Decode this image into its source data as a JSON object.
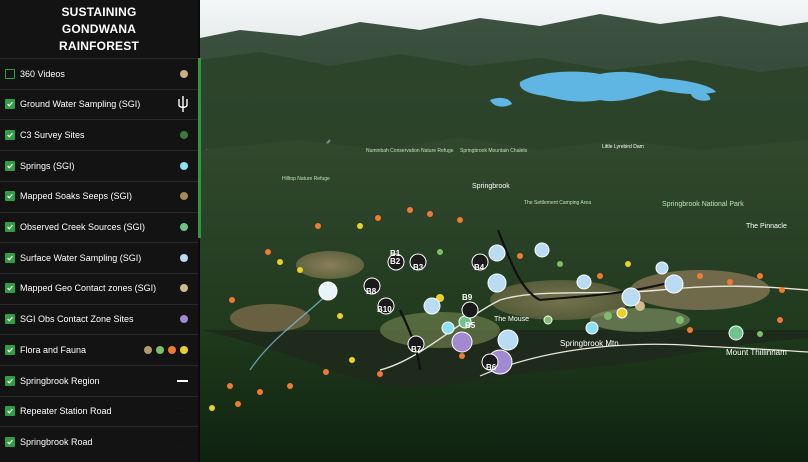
{
  "sidebar": {
    "title": "SUSTAINING GONDWANA RAINFOREST",
    "layers": [
      {
        "label": "360 Videos",
        "checked": false,
        "legend": "dot",
        "colors": [
          "#c9b17f"
        ]
      },
      {
        "label": "Ground Water Sampling (SGI)",
        "checked": true,
        "legend": "pin-icon",
        "colors": [
          "#ffffff"
        ]
      },
      {
        "label": "C3 Survey Sites",
        "checked": true,
        "legend": "dot",
        "colors": [
          "#3c7a3a"
        ]
      },
      {
        "label": "Springs (SGI)",
        "checked": true,
        "legend": "dot",
        "colors": [
          "#8ee0f5"
        ]
      },
      {
        "label": "Mapped Soaks Seeps (SGI)",
        "checked": true,
        "legend": "dot",
        "colors": [
          "#a68a55"
        ]
      },
      {
        "label": "Observed Creek Sources (SGI)",
        "checked": true,
        "legend": "dot",
        "colors": [
          "#6ec48a"
        ]
      },
      {
        "label": "Surface Water Sampling (SGI)",
        "checked": true,
        "legend": "dot",
        "colors": [
          "#b9dcf3"
        ]
      },
      {
        "label": "Mapped Geo Contact zones (SGI)",
        "checked": true,
        "legend": "dot",
        "colors": [
          "#d1b98e"
        ]
      },
      {
        "label": "SGI Obs Contact Zone Sites",
        "checked": true,
        "legend": "dot",
        "colors": [
          "#a28ad0"
        ]
      },
      {
        "label": "Flora and Fauna",
        "checked": true,
        "legend": "dots",
        "colors": [
          "#b59a6a",
          "#7bbf6a",
          "#f07a33",
          "#ead12a"
        ]
      },
      {
        "label": "Springbrook Region",
        "checked": true,
        "legend": "line",
        "colors": [
          "#ffffff"
        ]
      },
      {
        "label": "Repeater Station Road",
        "checked": true,
        "legend": "line",
        "colors": [
          "#111111"
        ]
      },
      {
        "label": "Springbrook Road",
        "checked": true,
        "legend": "line",
        "colors": [
          "#111111"
        ]
      }
    ]
  },
  "map": {
    "places": {
      "springbrook": "Springbrook",
      "national_park": "Springbrook National Park",
      "the_pinnacle": "The Pinnacle",
      "springbrook_mtn": "Springbrook Mtn",
      "mount_thillinnam": "Mount Thillinnam",
      "the_mouse": "The Mouse",
      "numinbah_refuge": "Numinbah Conservation Nature Refuge",
      "mountain_chalets": "Springbrook Mountain Chalets",
      "camping_area": "The Settlement Camping Area",
      "nature_refuge": "Hilltop Nature Refuge",
      "lyre_tail": "Little Lyrebird Dam"
    },
    "site_markers": [
      "B1",
      "B2",
      "B3",
      "B4",
      "B5",
      "B6",
      "B7",
      "B8",
      "B9",
      "B10"
    ]
  },
  "colors": {
    "accent": "#2f9e45",
    "sidebar_bg": "#131313",
    "water": "#5fb6e2"
  }
}
